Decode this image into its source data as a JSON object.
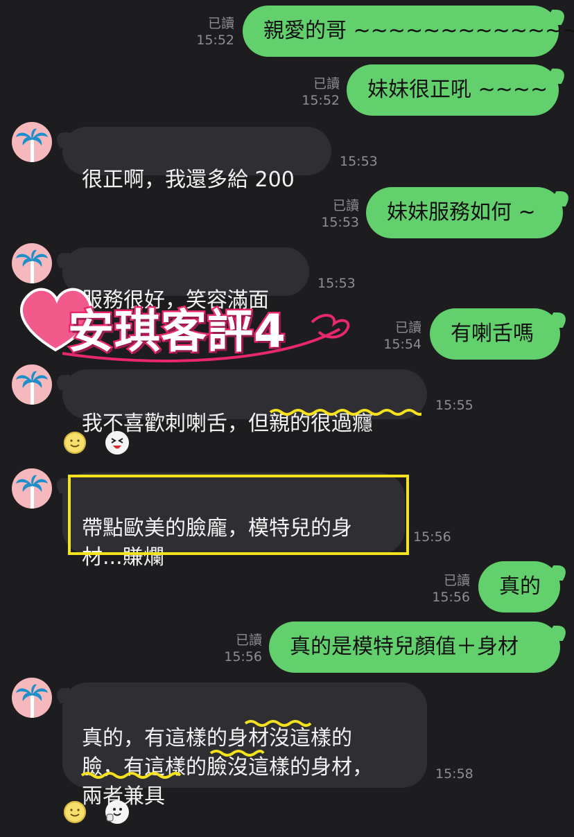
{
  "messages": [
    {
      "dir": "out",
      "text": "親愛的哥 ~~~~~~~~~~~~~~",
      "read": "已讀",
      "time": "15:52"
    },
    {
      "dir": "out",
      "text": "妹妹很正吼 ~~~~",
      "read": "已讀",
      "time": "15:52"
    },
    {
      "dir": "in",
      "text": "很正啊，我還多給 200",
      "time": "15:53"
    },
    {
      "dir": "out",
      "text": "妹妹服務如何 ~",
      "read": "已讀",
      "time": "15:53"
    },
    {
      "dir": "in",
      "text": "服務很好，笑容滿面",
      "time": "15:53"
    },
    {
      "dir": "out",
      "text": "有喇舌嗎",
      "read": "已讀",
      "time": "15:54"
    },
    {
      "dir": "in",
      "text": "我不喜歡刺喇舌，但親的很過癮",
      "time": "15:55"
    },
    {
      "dir": "in",
      "text": "帶點歐美的臉龐，模特兒的身\n材...賺爛",
      "time": "15:56"
    },
    {
      "dir": "out",
      "text": "真的",
      "read": "已讀",
      "time": "15:56"
    },
    {
      "dir": "out",
      "text": "真的是模特兒顏值＋身材",
      "read": "已讀",
      "time": "15:56"
    },
    {
      "dir": "in",
      "text": "真的，有這樣的身材沒這樣的\n臉，有這樣的臉沒這樣的身材，\n兩者兼具",
      "time": "15:58"
    }
  ],
  "overlay_sticker": {
    "text": "安琪客評4"
  },
  "colors": {
    "background": "#1d1d1f",
    "bubble_out": "#62d06c",
    "bubble_in": "#2f2f33",
    "meta_text": "#8e8e93",
    "highlight": "#f3e21c",
    "sticker_pink": "#e8286b"
  },
  "icons": {
    "avatar": "palm-tree-icon",
    "reaction_smile": "smile-emoji-icon",
    "reaction_face": "laughing-face-icon",
    "reaction_thumb": "thumbs-up-face-icon"
  }
}
